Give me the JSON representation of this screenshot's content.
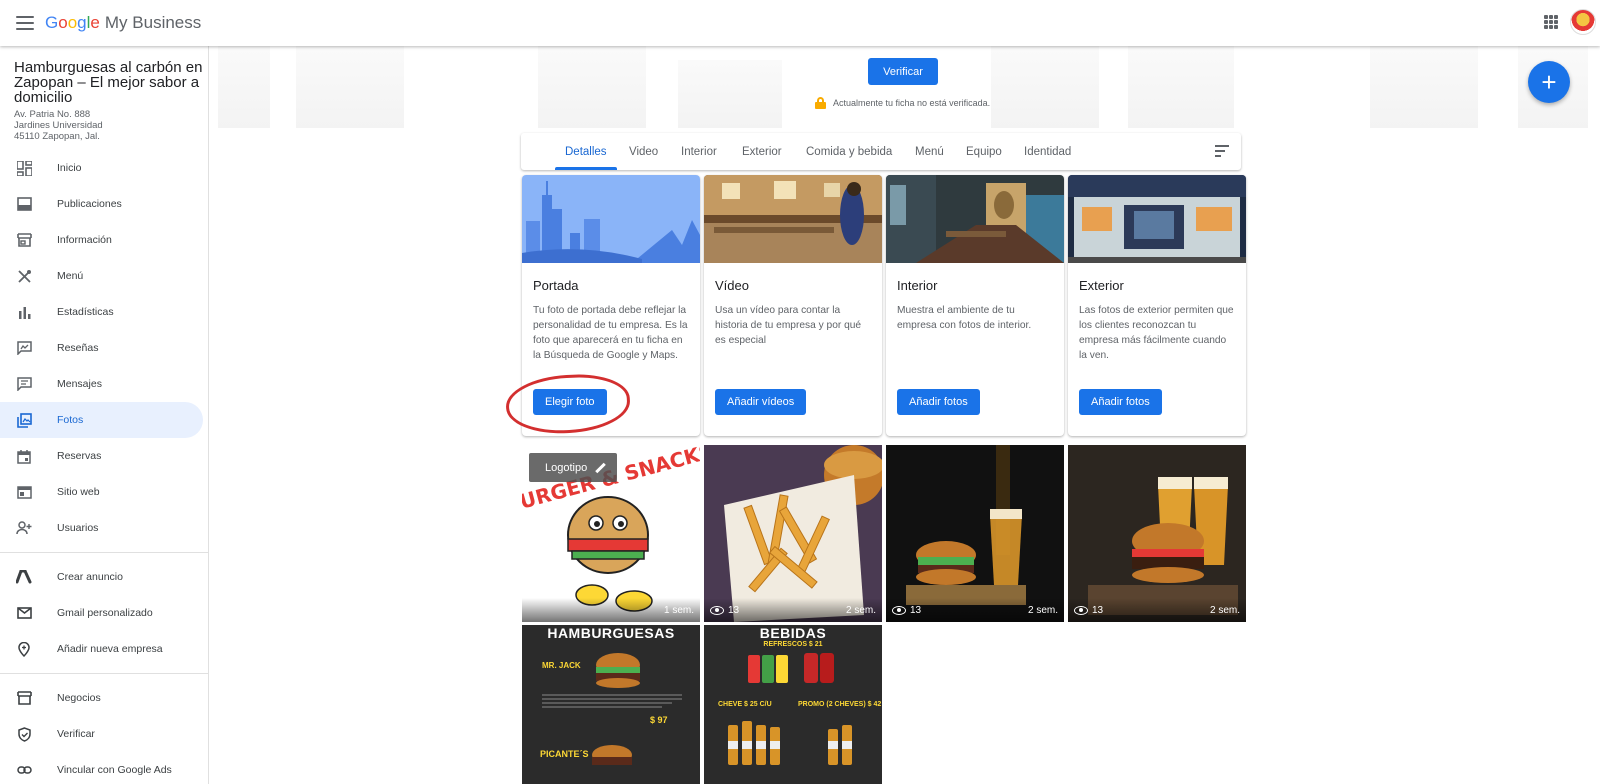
{
  "topbar": {
    "logo_letters": [
      "G",
      "o",
      "o",
      "g",
      "l",
      "e"
    ],
    "logo_suffix": "My Business"
  },
  "sidebar": {
    "business_name": "Hamburguesas al carbón en Zapopan – El mejor sabor a domicilio",
    "address": [
      "Av. Patria No. 888",
      "Jardines Universidad",
      "45110 Zapopan, Jal."
    ],
    "items": [
      {
        "label": "Inicio",
        "icon": "dashboard-icon"
      },
      {
        "label": "Publicaciones",
        "icon": "posts-icon"
      },
      {
        "label": "Información",
        "icon": "storefront-icon"
      },
      {
        "label": "Menú",
        "icon": "restaurant-icon"
      },
      {
        "label": "Estadísticas",
        "icon": "bar-chart-icon"
      },
      {
        "label": "Reseñas",
        "icon": "reviews-icon"
      },
      {
        "label": "Mensajes",
        "icon": "messages-icon"
      },
      {
        "label": "Fotos",
        "icon": "photos-icon",
        "active": true
      },
      {
        "label": "Reservas",
        "icon": "calendar-icon"
      },
      {
        "label": "Sitio web",
        "icon": "website-icon"
      },
      {
        "label": "Usuarios",
        "icon": "add-user-icon"
      }
    ],
    "items2": [
      {
        "label": "Crear anuncio",
        "icon": "google-ads-icon"
      },
      {
        "label": "Gmail personalizado",
        "icon": "gmail-icon"
      },
      {
        "label": "Añadir nueva empresa",
        "icon": "location-pin-icon"
      }
    ],
    "items3": [
      {
        "label": "Negocios",
        "icon": "storefront-icon"
      },
      {
        "label": "Verificar",
        "icon": "verified-shield-icon"
      },
      {
        "label": "Vincular con Google Ads",
        "icon": "link-icon"
      }
    ]
  },
  "banner": {
    "verify_label": "Verificar",
    "note": "Actualmente tu ficha no está verificada."
  },
  "tabs": [
    "Detalles",
    "Video",
    "Interior",
    "Exterior",
    "Comida y bebida",
    "Menú",
    "Equipo",
    "Identidad"
  ],
  "cards": [
    {
      "title": "Portada",
      "desc": "Tu foto de portada debe reflejar la personalidad de tu empresa. Es la foto que aparecerá en tu ficha en la Búsqueda de Google y Maps.",
      "button": "Elegir foto"
    },
    {
      "title": "Vídeo",
      "desc": "Usa un vídeo para contar la historia de tu empresa y por qué es especial",
      "button": "Añadir vídeos"
    },
    {
      "title": "Interior",
      "desc": "Muestra el ambiente de tu empresa con fotos de interior.",
      "button": "Añadir fotos"
    },
    {
      "title": "Exterior",
      "desc": "Las fotos de exterior permiten que los clientes reconozcan tu empresa más fácilmente cuando la ven.",
      "button": "Añadir fotos"
    }
  ],
  "photos": [
    {
      "chip": "Logotipo",
      "views": "",
      "age": "1 sem.",
      "text": "BURGER & SNACKS"
    },
    {
      "views": "13",
      "age": "2 sem."
    },
    {
      "views": "13",
      "age": "2 sem."
    },
    {
      "views": "13",
      "age": "2 sem."
    },
    {
      "title": "HAMBURGUESAS",
      "lines": [
        "MR. JACK",
        "$ 97",
        "PICANTE´S"
      ]
    },
    {
      "title": "BEBIDAS",
      "lines": [
        "REFRESCOS $ 21",
        "CHEVE $ 25 C/U",
        "PROMO (2 CHEVES) $ 42"
      ]
    }
  ],
  "colors": {
    "accent": "#1a73e8",
    "active_bg": "#e8f0fe",
    "annotation": "#d32f2f"
  }
}
